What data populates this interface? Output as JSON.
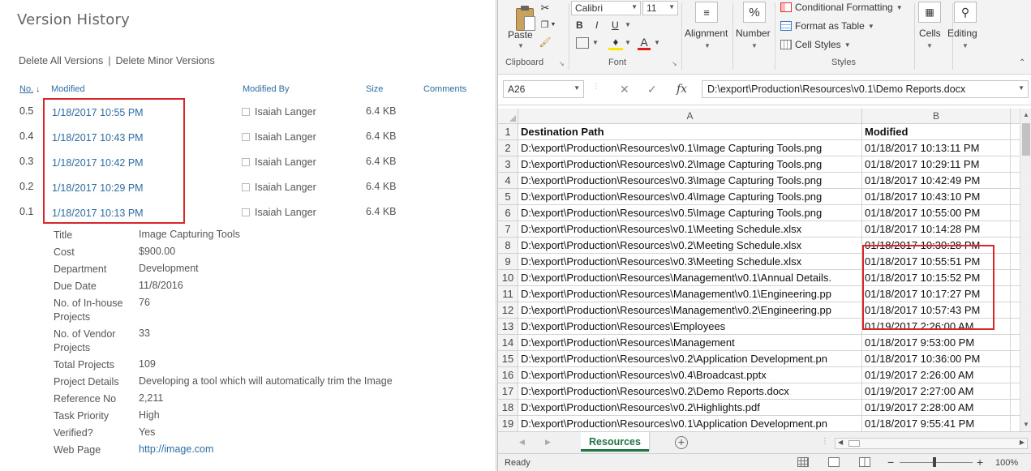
{
  "version_history": {
    "title": "Version History",
    "actions": {
      "delete_all": "Delete All Versions",
      "separator": "|",
      "delete_minor": "Delete Minor Versions"
    },
    "headers": {
      "no": "No.",
      "modified": "Modified",
      "modified_by": "Modified By",
      "size": "Size",
      "comments": "Comments"
    },
    "versions": [
      {
        "no": "0.5",
        "modified": "1/18/2017 10:55 PM",
        "by": "Isaiah Langer",
        "size": "6.4 KB"
      },
      {
        "no": "0.4",
        "modified": "1/18/2017 10:43 PM",
        "by": "Isaiah Langer",
        "size": "6.4 KB"
      },
      {
        "no": "0.3",
        "modified": "1/18/2017 10:42 PM",
        "by": "Isaiah Langer",
        "size": "6.4 KB"
      },
      {
        "no": "0.2",
        "modified": "1/18/2017 10:29 PM",
        "by": "Isaiah Langer",
        "size": "6.4 KB"
      },
      {
        "no": "0.1",
        "modified": "1/18/2017 10:13 PM",
        "by": "Isaiah Langer",
        "size": "6.4 KB"
      }
    ],
    "properties": [
      {
        "key": "Title",
        "value": "Image Capturing Tools"
      },
      {
        "key": "Cost",
        "value": "$900.00"
      },
      {
        "key": "Department",
        "value": "Development"
      },
      {
        "key": "Due Date",
        "value": "11/8/2016"
      },
      {
        "key": "No. of In-house Projects",
        "value": "76"
      },
      {
        "key": "No. of Vendor Projects",
        "value": "33"
      },
      {
        "key": "Total Projects",
        "value": "109"
      },
      {
        "key": "Project Details",
        "value": "Developing a tool which will automatically trim the Image"
      },
      {
        "key": "Reference No",
        "value": "2,211"
      },
      {
        "key": "Task Priority",
        "value": "High"
      },
      {
        "key": "Verified?",
        "value": "Yes"
      },
      {
        "key": "Web Page",
        "value": "http://image.com"
      }
    ]
  },
  "excel": {
    "ribbon": {
      "paste": "Paste",
      "clipboard": "Clipboard",
      "font_name": "Calibri",
      "font_size": "11",
      "bold": "B",
      "italic": "I",
      "underline": "U",
      "font_group": "Font",
      "alignment": "Alignment",
      "number": "Number",
      "number_symbol": "%",
      "conditional_formatting": "Conditional Formatting",
      "format_as_table": "Format as Table",
      "cell_styles": "Cell Styles",
      "styles_group": "Styles",
      "cells": "Cells",
      "editing": "Editing"
    },
    "name_box": "A26",
    "formula": "D:\\export\\Production\\Resources\\v0.1\\Demo Reports.docx",
    "columns": [
      "A",
      "B"
    ],
    "rows": [
      {
        "n": "1",
        "a": "Destination Path",
        "b": "Modified"
      },
      {
        "n": "2",
        "a": "D:\\export\\Production\\Resources\\v0.1\\Image Capturing Tools.png",
        "b": "01/18/2017 10:13:11 PM"
      },
      {
        "n": "3",
        "a": "D:\\export\\Production\\Resources\\v0.2\\Image Capturing Tools.png",
        "b": "01/18/2017 10:29:11 PM"
      },
      {
        "n": "4",
        "a": "D:\\export\\Production\\Resources\\v0.3\\Image Capturing Tools.png",
        "b": "01/18/2017 10:42:49 PM"
      },
      {
        "n": "5",
        "a": "D:\\export\\Production\\Resources\\v0.4\\Image Capturing Tools.png",
        "b": "01/18/2017 10:43:10 PM"
      },
      {
        "n": "6",
        "a": "D:\\export\\Production\\Resources\\v0.5\\Image Capturing Tools.png",
        "b": "01/18/2017 10:55:00 PM"
      },
      {
        "n": "7",
        "a": "D:\\export\\Production\\Resources\\v0.1\\Meeting Schedule.xlsx",
        "b": "01/18/2017 10:14:28 PM"
      },
      {
        "n": "8",
        "a": "D:\\export\\Production\\Resources\\v0.2\\Meeting Schedule.xlsx",
        "b": "01/18/2017 10:30:28 PM"
      },
      {
        "n": "9",
        "a": "D:\\export\\Production\\Resources\\v0.3\\Meeting Schedule.xlsx",
        "b": "01/18/2017 10:55:51 PM"
      },
      {
        "n": "10",
        "a": "D:\\export\\Production\\Resources\\Management\\v0.1\\Annual Details.",
        "b": "01/18/2017 10:15:52 PM"
      },
      {
        "n": "11",
        "a": "D:\\export\\Production\\Resources\\Management\\v0.1\\Engineering.pp",
        "b": "01/18/2017 10:17:27 PM"
      },
      {
        "n": "12",
        "a": "D:\\export\\Production\\Resources\\Management\\v0.2\\Engineering.pp",
        "b": "01/18/2017 10:57:43 PM"
      },
      {
        "n": "13",
        "a": "D:\\export\\Production\\Resources\\Employees",
        "b": "01/19/2017 2:26:00 AM"
      },
      {
        "n": "14",
        "a": "D:\\export\\Production\\Resources\\Management",
        "b": "01/18/2017 9:53:00 PM"
      },
      {
        "n": "15",
        "a": "D:\\export\\Production\\Resources\\v0.2\\Application Development.pn",
        "b": "01/18/2017 10:36:00 PM"
      },
      {
        "n": "16",
        "a": "D:\\export\\Production\\Resources\\v0.4\\Broadcast.pptx",
        "b": "01/19/2017 2:26:00 AM"
      },
      {
        "n": "17",
        "a": "D:\\export\\Production\\Resources\\v0.2\\Demo Reports.docx",
        "b": "01/19/2017 2:27:00 AM"
      },
      {
        "n": "18",
        "a": "D:\\export\\Production\\Resources\\v0.2\\Highlights.pdf",
        "b": "01/19/2017 2:28:00 AM"
      },
      {
        "n": "19",
        "a": "D:\\export\\Production\\Resources\\v0.1\\Application Development.pn",
        "b": "01/18/2017 9:55:41 PM"
      }
    ],
    "sheet_tab": "Resources",
    "add_sheet": "+",
    "status": "Ready",
    "zoom": "100%",
    "colors": {
      "accent": "#217346",
      "highlight": "#d9262b",
      "link": "#2e6da4"
    }
  }
}
